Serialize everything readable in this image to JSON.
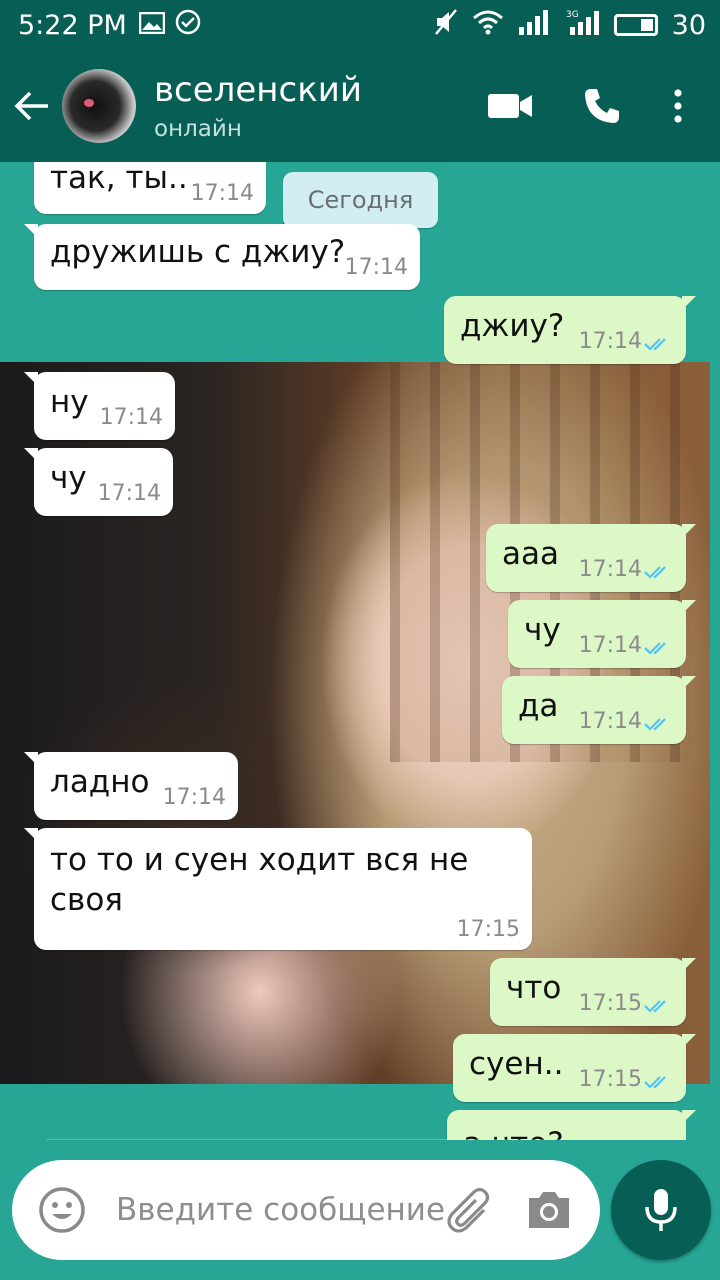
{
  "status_bar": {
    "time": "5:22 PM",
    "icons_left": [
      "image-icon",
      "check-circle-icon"
    ],
    "icons_right": [
      "mute-icon",
      "wifi-icon",
      "signal-icon",
      "signal-3g-icon",
      "battery-icon"
    ],
    "battery": "30"
  },
  "header": {
    "contact_name": "вселенский",
    "contact_status": "онлайн",
    "actions": [
      "video-call-icon",
      "phone-icon",
      "more-vert-icon"
    ]
  },
  "chat": {
    "date_chip": "Сегодня",
    "messages": [
      {
        "dir": "in",
        "text": "так, ты..",
        "time": "17:14"
      },
      {
        "dir": "in",
        "text": "дружишь с джиу?",
        "time": "17:14"
      },
      {
        "dir": "out",
        "text": "джиу?",
        "time": "17:14"
      },
      {
        "dir": "in",
        "text": "ну",
        "time": "17:14"
      },
      {
        "dir": "in",
        "text": "чу",
        "time": "17:14"
      },
      {
        "dir": "out",
        "text": "ааа",
        "time": "17:14"
      },
      {
        "dir": "out",
        "text": "чу",
        "time": "17:14"
      },
      {
        "dir": "out",
        "text": "да",
        "time": "17:14"
      },
      {
        "dir": "in",
        "text": "ладно",
        "time": "17:14"
      },
      {
        "dir": "in",
        "text_line1": "то то и суен ходит вся не",
        "text_line2": "своя",
        "time": "17:15"
      },
      {
        "dir": "out",
        "text": "что",
        "time": "17:15"
      },
      {
        "dir": "out",
        "text": "суен..",
        "time": "17:15"
      },
      {
        "dir": "out",
        "text": "а что?",
        "time": ""
      }
    ]
  },
  "composer": {
    "placeholder": "Введите сообщение"
  },
  "colors": {
    "header": "#075e54",
    "chat_bg": "#27a595",
    "bubble_out": "#dcf8c6",
    "bubble_in": "#ffffff",
    "read_ticks": "#4fc3f7"
  }
}
